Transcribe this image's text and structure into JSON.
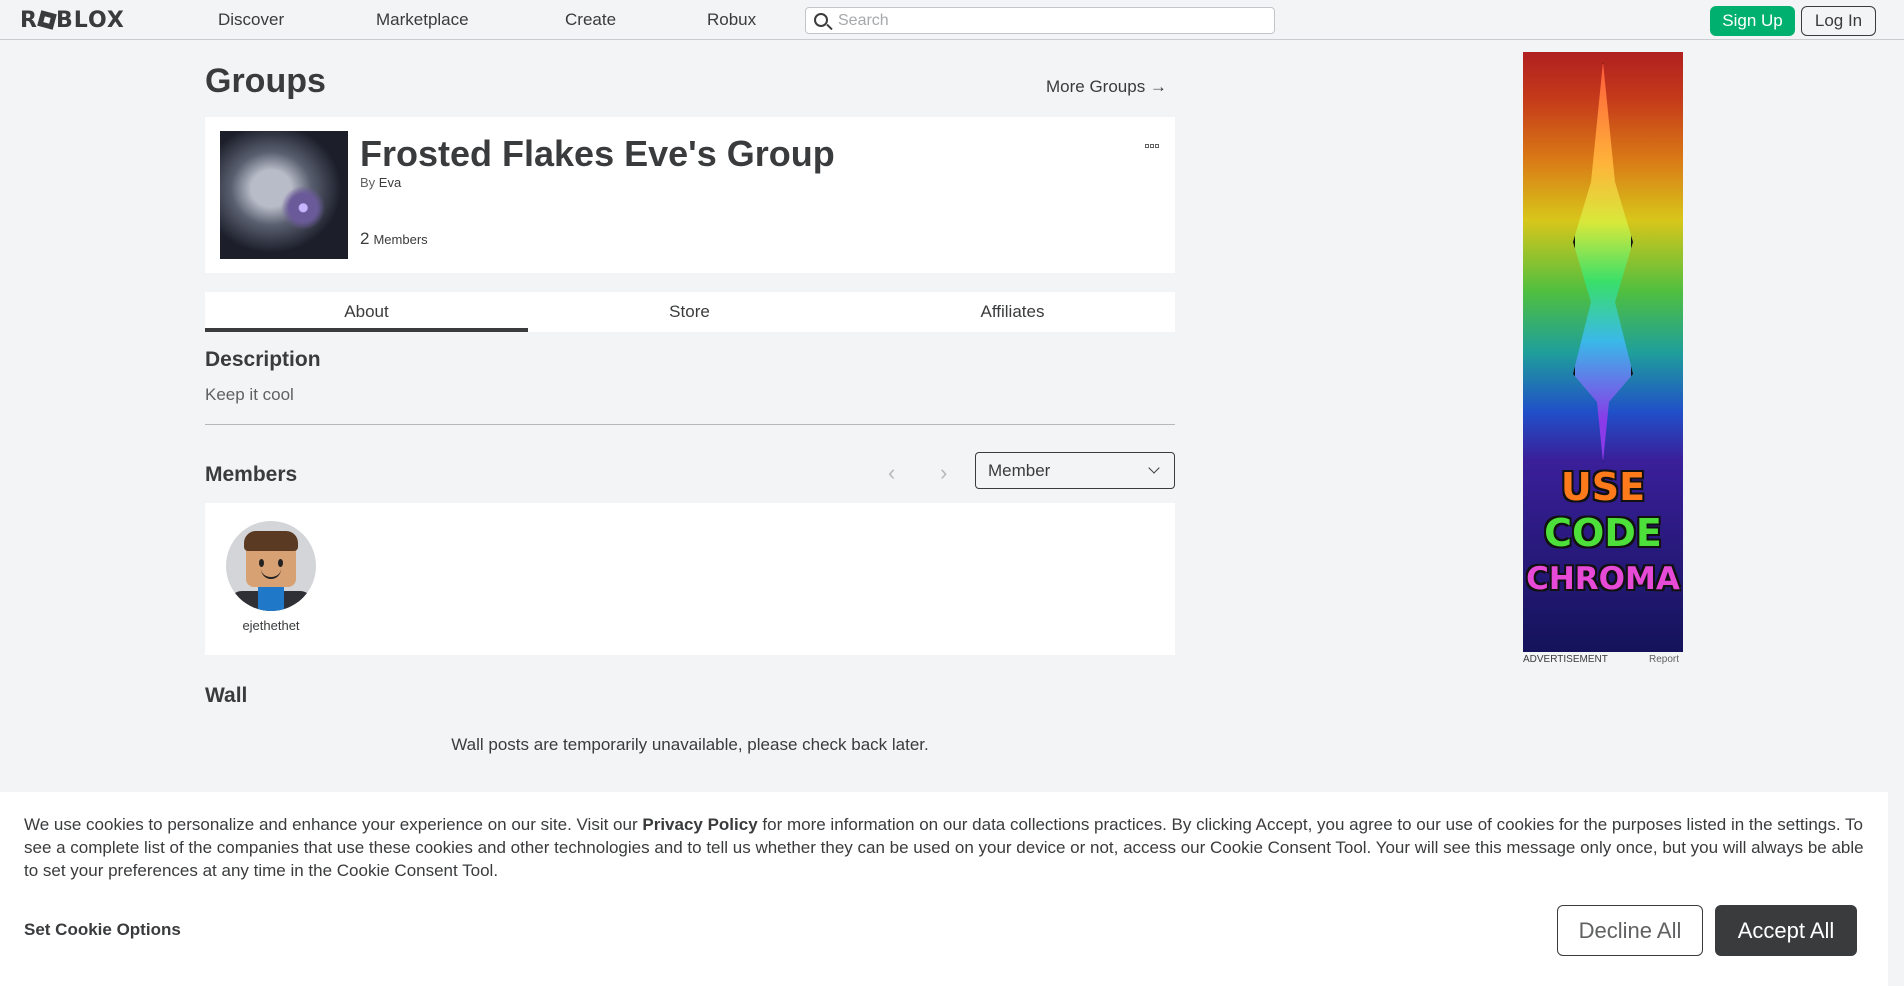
{
  "nav": {
    "logo": "ROBLOX",
    "logo_prefix": "R",
    "logo_suffix": "BLOX",
    "items": [
      "Discover",
      "Marketplace",
      "Create",
      "Robux"
    ],
    "search_placeholder": "Search",
    "signup_label": "Sign Up",
    "login_label": "Log In"
  },
  "page": {
    "title": "Groups",
    "more_groups": "More Groups →"
  },
  "group": {
    "name": "Frosted Flakes Eve's Group",
    "by_label": "By",
    "owner": "Eva",
    "member_count": "2",
    "members_label": "Members"
  },
  "tabs": [
    "About",
    "Store",
    "Affiliates"
  ],
  "active_tab": "About",
  "description": {
    "heading": "Description",
    "text": "Keep it cool"
  },
  "members": {
    "heading": "Members",
    "role_selected": "Member",
    "list": [
      {
        "username": "ejethethet"
      }
    ]
  },
  "wall": {
    "heading": "Wall",
    "message": "Wall posts are temporarily unavailable, please check back later."
  },
  "ad": {
    "lines": [
      "USE",
      "CODE",
      "CHROMA"
    ],
    "label": "ADVERTISEMENT",
    "report": "Report"
  },
  "cookie": {
    "text_before": "We use cookies to personalize and enhance your experience on our site. Visit our ",
    "privacy_link": "Privacy Policy",
    "text_after": " for more information on our data collections practices. By clicking Accept, you agree to our use of cookies for the purposes listed in the settings. To see a complete list of the companies that use these cookies and other technologies and to tell us whether they can be used on your device or not, access our Cookie Consent Tool. Your will see this message only once, but you will always be able to set your preferences at any time in the Cookie Consent Tool.",
    "set_options": "Set Cookie Options",
    "decline": "Decline All",
    "accept": "Accept All"
  },
  "colors": {
    "accent_green": "#00b06f",
    "text_dark": "#393b3d",
    "background": "#f2f4f5"
  }
}
